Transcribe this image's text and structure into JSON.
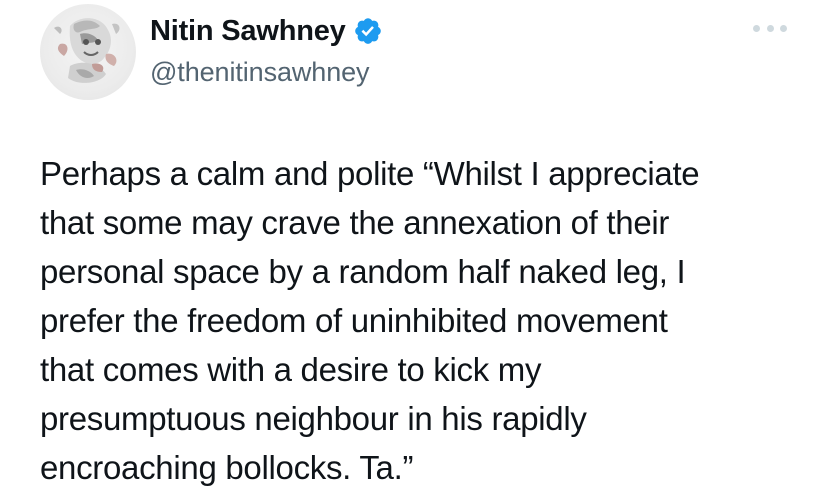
{
  "author": {
    "display_name": "Nitin Sawhney",
    "handle": "@thenitinsawhney",
    "verified_icon": "verified-badge-icon",
    "avatar_icon": "profile-photo"
  },
  "menu": {
    "icon": "more-options-icon"
  },
  "tweet": {
    "text": "Perhaps a calm and polite  “Whilst I appreciate\nthat some may crave the annexation of their\npersonal space by a random half naked leg, I\nprefer the freedom of uninhibited movement\nthat comes with a desire to kick my\npresumptuous neighbour in his rapidly\nencroaching bollocks. Ta.”"
  },
  "colors": {
    "text_primary": "#0f1419",
    "text_secondary": "#536471",
    "verified_blue": "#1d9bf0",
    "menu_dots": "#cfd9de"
  }
}
